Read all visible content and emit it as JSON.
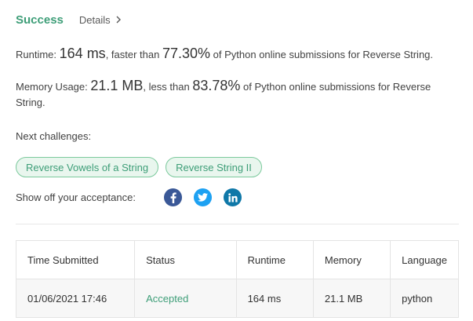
{
  "header": {
    "status": "Success",
    "details_label": "Details"
  },
  "runtime": {
    "label": "Runtime:",
    "value": "164 ms",
    "text1": ", faster than",
    "percent": "77.30%",
    "text2": "of Python online submissions for Reverse String."
  },
  "memory": {
    "label": "Memory Usage:",
    "value": "21.1 MB",
    "text1": ", less than",
    "percent": "83.78%",
    "text2": "of Python online submissions for Reverse",
    "text3": "String."
  },
  "next": {
    "label": "Next challenges:",
    "challenges": [
      "Reverse Vowels of a String",
      "Reverse String II"
    ]
  },
  "share": {
    "label": "Show off your acceptance:",
    "icons": [
      "facebook-icon",
      "twitter-icon",
      "linkedin-icon"
    ]
  },
  "table": {
    "headers": [
      "Time Submitted",
      "Status",
      "Runtime",
      "Memory",
      "Language"
    ],
    "rows": [
      [
        "01/06/2021 17:46",
        "Accepted",
        "164 ms",
        "21.1 MB",
        "python"
      ]
    ]
  },
  "colors": {
    "accent": "#3e9e78",
    "facebook": "#3a5897",
    "twitter": "#1da1f2",
    "linkedin": "#0f78a8"
  }
}
